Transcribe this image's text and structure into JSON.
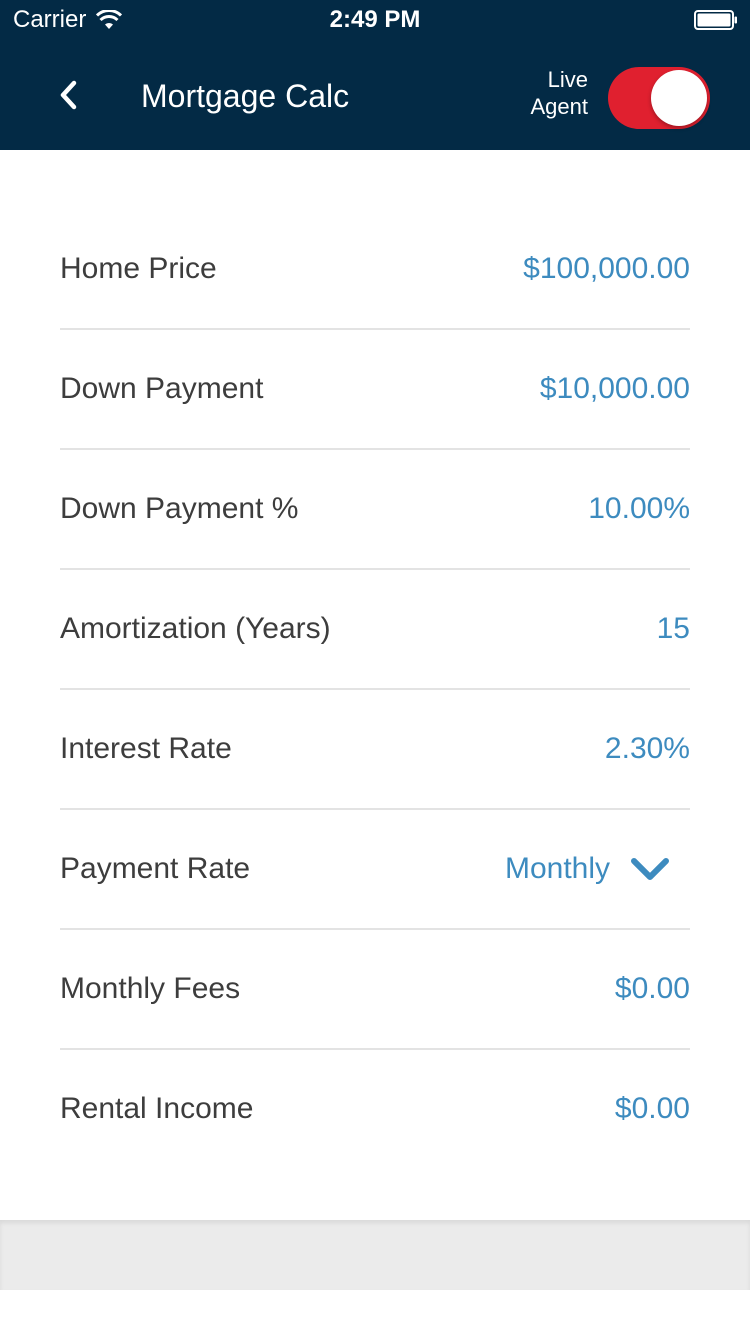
{
  "status_bar": {
    "carrier": "Carrier",
    "time": "2:49 PM"
  },
  "nav": {
    "title": "Mortgage Calc",
    "live_agent_line1": "Live",
    "live_agent_line2": "Agent",
    "live_agent_on": true,
    "toggle_color": "#e0202f",
    "header_color": "#032a45"
  },
  "rows": [
    {
      "label": "Home Price",
      "value": "$100,000.00"
    },
    {
      "label": "Down Payment",
      "value": "$10,000.00"
    },
    {
      "label": "Down Payment %",
      "value": "10.00%"
    },
    {
      "label": "Amortization (Years)",
      "value": "15"
    },
    {
      "label": "Interest Rate",
      "value": "2.30%"
    },
    {
      "label": "Payment Rate",
      "value": "Monthly",
      "icon": "chevron-down-icon"
    },
    {
      "label": "Monthly Fees",
      "value": "$0.00"
    },
    {
      "label": "Rental Income",
      "value": "$0.00"
    }
  ],
  "colors": {
    "value_text": "#3d8bbf",
    "label_text": "#3d3d3d"
  }
}
